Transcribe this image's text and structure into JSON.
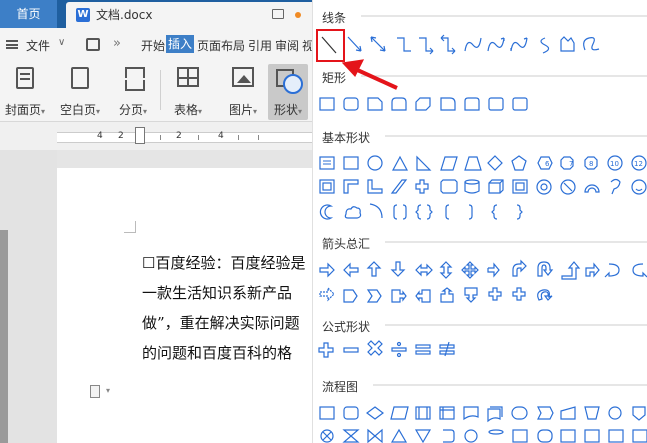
{
  "tabs": {
    "home": "首页",
    "doc_title": "文档.docx",
    "doc_icon": "W"
  },
  "menubar": {
    "file": "文件",
    "items": [
      "开始",
      "插入",
      "页面布局",
      "引用",
      "审阅",
      "视"
    ]
  },
  "ribbon": {
    "buttons": [
      {
        "label": "封面页",
        "icon": "cover-page-icon"
      },
      {
        "label": "空白页",
        "icon": "blank-page-icon"
      },
      {
        "label": "分页",
        "icon": "page-break-icon"
      },
      {
        "label": "表格",
        "icon": "table-icon"
      },
      {
        "label": "图片",
        "icon": "picture-icon"
      },
      {
        "label": "形状",
        "icon": "shape-icon"
      }
    ]
  },
  "ruler": {
    "numbers": [
      "4",
      "2",
      "2",
      "4"
    ]
  },
  "document": {
    "lines": [
      "☐百度经验：百度经验是",
      "一款生活知识系新产品",
      "做”，重在解决实际问题",
      "的问题和百度百科的格"
    ]
  },
  "shape_panel": {
    "sections": [
      "线条",
      "矩形",
      "基本形状",
      "箭头总汇",
      "公式形状",
      "流程图"
    ],
    "highlighted_shape": "straight-line",
    "accent_color": "#2b6fd6",
    "highlight_color": "#e4141a"
  }
}
